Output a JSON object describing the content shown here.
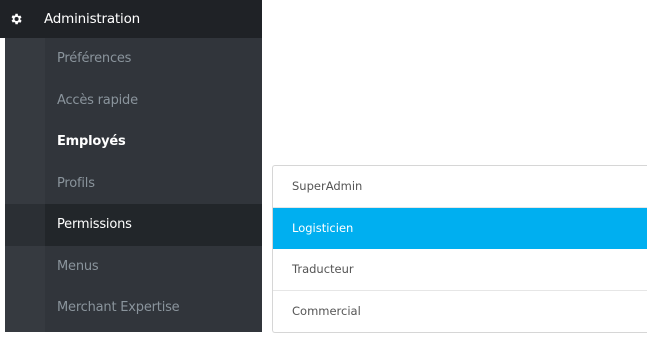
{
  "menu": {
    "title": "Administration",
    "icon": "gear-icon",
    "items": [
      {
        "label": "Préférences",
        "state": "normal"
      },
      {
        "label": "Accès rapide",
        "state": "normal"
      },
      {
        "label": "Employés",
        "state": "highlighted"
      },
      {
        "label": "Profils",
        "state": "normal"
      },
      {
        "label": "Permissions",
        "state": "active"
      },
      {
        "label": "Menus",
        "state": "normal"
      },
      {
        "label": "Merchant Expertise",
        "state": "normal"
      }
    ]
  },
  "profiles": {
    "selected": "Logisticien",
    "items": [
      {
        "label": "SuperAdmin"
      },
      {
        "label": "Logisticien"
      },
      {
        "label": "Traducteur"
      },
      {
        "label": "Commercial"
      }
    ]
  },
  "colors": {
    "menu_header_bg": "#1f2226",
    "submenu_bg": "#31353b",
    "submenu_active_bg": "#22262a",
    "submenu_text": "#8a949c",
    "selected_profile_bg": "#00aff0"
  }
}
